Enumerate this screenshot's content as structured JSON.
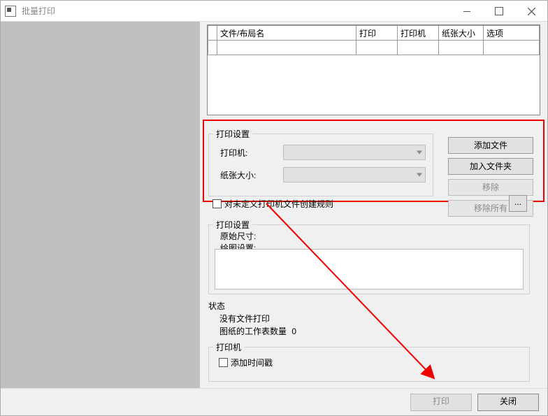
{
  "window": {
    "title": "批量打印"
  },
  "table": {
    "headers": {
      "file_layout": "文件/布局名",
      "print": "打印",
      "printer": "打印机",
      "paper": "纸张大小",
      "options": "选项"
    }
  },
  "print_setting_box": {
    "legend": "打印设置",
    "printer_label": "打印机:",
    "paper_label": "纸张大小:"
  },
  "rule": {
    "checkbox_label": "对未定义打印机文件创建规则",
    "ellipsis": "..."
  },
  "buttons": {
    "add_file": "添加文件",
    "add_folder": "加入文件夹",
    "remove": "移除",
    "remove_all": "移除所有"
  },
  "print_setting_box2": {
    "legend": "打印设置",
    "orig_size": "原始尺寸:",
    "plot_setting": "绘图设置:"
  },
  "status": {
    "legend": "状态",
    "no_file": "没有文件打印",
    "sheet_count_label": "图纸的工作表数量",
    "sheet_count_value": "0"
  },
  "printer_box": {
    "legend": "打印机",
    "timestamp_label": "添加时间戳"
  },
  "footer": {
    "print": "打印",
    "close": "关闭"
  }
}
